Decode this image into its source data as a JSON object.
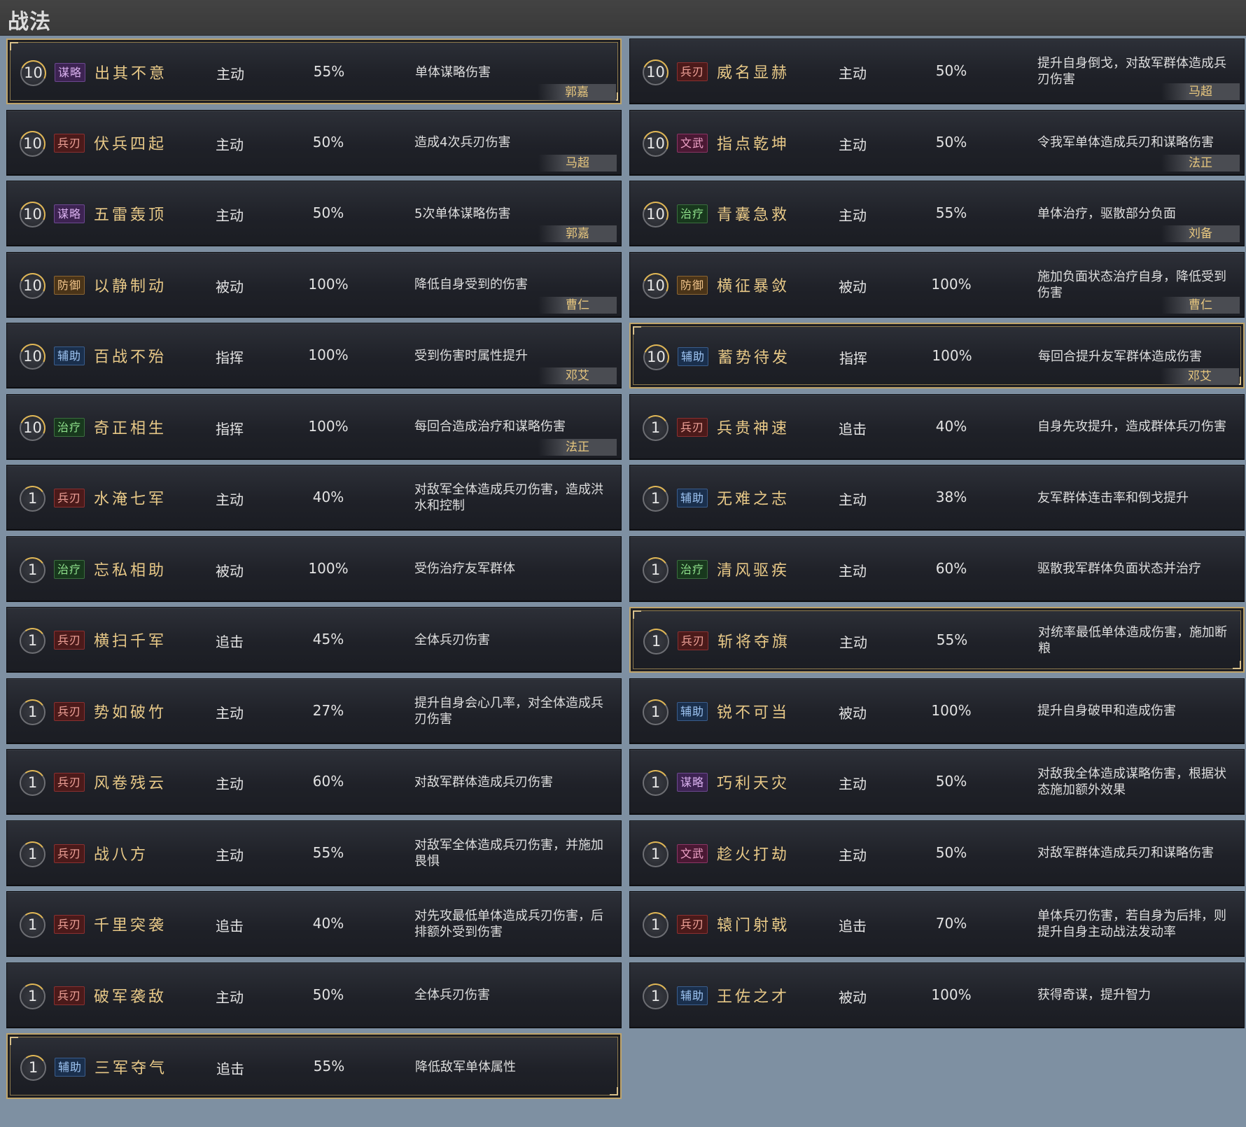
{
  "window": {
    "title": "战法"
  },
  "left_column": [
    {
      "level": "10",
      "category": "谋略",
      "cls": "c-moulue",
      "name": "出其不意",
      "type": "主动",
      "rate": "55%",
      "desc": "单体谋略伤害",
      "owner": "郭嘉",
      "highlight": true
    },
    {
      "level": "10",
      "category": "兵刃",
      "cls": "c-bingren",
      "name": "伏兵四起",
      "type": "主动",
      "rate": "50%",
      "desc": "造成4次兵刃伤害",
      "owner": "马超",
      "highlight": false
    },
    {
      "level": "10",
      "category": "谋略",
      "cls": "c-moulue",
      "name": "五雷轰顶",
      "type": "主动",
      "rate": "50%",
      "desc": "5次单体谋略伤害",
      "owner": "郭嘉",
      "highlight": false
    },
    {
      "level": "10",
      "category": "防御",
      "cls": "c-fangyu",
      "name": "以静制动",
      "type": "被动",
      "rate": "100%",
      "desc": "降低自身受到的伤害",
      "owner": "曹仁",
      "highlight": false
    },
    {
      "level": "10",
      "category": "辅助",
      "cls": "c-fuzhu",
      "name": "百战不殆",
      "type": "指挥",
      "rate": "100%",
      "desc": "受到伤害时属性提升",
      "owner": "邓艾",
      "highlight": false
    },
    {
      "level": "10",
      "category": "治疗",
      "cls": "c-zhiliao",
      "name": "奇正相生",
      "type": "指挥",
      "rate": "100%",
      "desc": "每回合造成治疗和谋略伤害",
      "owner": "法正",
      "highlight": false
    },
    {
      "level": "1",
      "category": "兵刃",
      "cls": "c-bingren",
      "name": "水淹七军",
      "type": "主动",
      "rate": "40%",
      "desc": "对敌军全体造成兵刃伤害，造成洪水和控制",
      "owner": "",
      "highlight": false
    },
    {
      "level": "1",
      "category": "治疗",
      "cls": "c-zhiliao",
      "name": "忘私相助",
      "type": "被动",
      "rate": "100%",
      "desc": "受伤治疗友军群体",
      "owner": "",
      "highlight": false
    },
    {
      "level": "1",
      "category": "兵刃",
      "cls": "c-bingren",
      "name": "横扫千军",
      "type": "追击",
      "rate": "45%",
      "desc": "全体兵刃伤害",
      "owner": "",
      "highlight": false
    },
    {
      "level": "1",
      "category": "兵刃",
      "cls": "c-bingren",
      "name": "势如破竹",
      "type": "主动",
      "rate": "27%",
      "desc": "提升自身会心几率，对全体造成兵刃伤害",
      "owner": "",
      "highlight": false
    },
    {
      "level": "1",
      "category": "兵刃",
      "cls": "c-bingren",
      "name": "风卷残云",
      "type": "主动",
      "rate": "60%",
      "desc": "对敌军群体造成兵刃伤害",
      "owner": "",
      "highlight": false
    },
    {
      "level": "1",
      "category": "兵刃",
      "cls": "c-bingren",
      "name": "战八方",
      "type": "主动",
      "rate": "55%",
      "desc": "对敌军全体造成兵刃伤害，并施加畏惧",
      "owner": "",
      "highlight": false
    },
    {
      "level": "1",
      "category": "兵刃",
      "cls": "c-bingren",
      "name": "千里突袭",
      "type": "追击",
      "rate": "40%",
      "desc": "对先攻最低单体造成兵刃伤害，后排额外受到伤害",
      "owner": "",
      "highlight": false
    },
    {
      "level": "1",
      "category": "兵刃",
      "cls": "c-bingren",
      "name": "破军袭敌",
      "type": "主动",
      "rate": "50%",
      "desc": "全体兵刃伤害",
      "owner": "",
      "highlight": false
    },
    {
      "level": "1",
      "category": "辅助",
      "cls": "c-fuzhu",
      "name": "三军夺气",
      "type": "追击",
      "rate": "55%",
      "desc": "降低敌军单体属性",
      "owner": "",
      "highlight": true
    }
  ],
  "right_column": [
    {
      "level": "10",
      "category": "兵刃",
      "cls": "c-bingren",
      "name": "威名显赫",
      "type": "主动",
      "rate": "50%",
      "desc": "提升自身倒戈，对敌军群体造成兵刃伤害",
      "owner": "马超",
      "highlight": false
    },
    {
      "level": "10",
      "category": "文武",
      "cls": "c-wenwu",
      "name": "指点乾坤",
      "type": "主动",
      "rate": "50%",
      "desc": "令我军单体造成兵刃和谋略伤害",
      "owner": "法正",
      "highlight": false
    },
    {
      "level": "10",
      "category": "治疗",
      "cls": "c-zhiliao",
      "name": "青囊急救",
      "type": "主动",
      "rate": "55%",
      "desc": "单体治疗，驱散部分负面",
      "owner": "刘备",
      "highlight": false
    },
    {
      "level": "10",
      "category": "防御",
      "cls": "c-fangyu",
      "name": "横征暴敛",
      "type": "被动",
      "rate": "100%",
      "desc": "施加负面状态治疗自身，降低受到伤害",
      "owner": "曹仁",
      "highlight": false
    },
    {
      "level": "10",
      "category": "辅助",
      "cls": "c-fuzhu",
      "name": "蓄势待发",
      "type": "指挥",
      "rate": "100%",
      "desc": "每回合提升友军群体造成伤害",
      "owner": "邓艾",
      "highlight": true
    },
    {
      "level": "1",
      "category": "兵刃",
      "cls": "c-bingren",
      "name": "兵贵神速",
      "type": "追击",
      "rate": "40%",
      "desc": "自身先攻提升，造成群体兵刃伤害",
      "owner": "",
      "highlight": false
    },
    {
      "level": "1",
      "category": "辅助",
      "cls": "c-fuzhu",
      "name": "无难之志",
      "type": "主动",
      "rate": "38%",
      "desc": "友军群体连击率和倒戈提升",
      "owner": "",
      "highlight": false
    },
    {
      "level": "1",
      "category": "治疗",
      "cls": "c-zhiliao",
      "name": "清风驱疾",
      "type": "主动",
      "rate": "60%",
      "desc": "驱散我军群体负面状态并治疗",
      "owner": "",
      "highlight": false
    },
    {
      "level": "1",
      "category": "兵刃",
      "cls": "c-bingren",
      "name": "斩将夺旗",
      "type": "主动",
      "rate": "55%",
      "desc": "对统率最低单体造成伤害，施加断粮",
      "owner": "",
      "highlight": true
    },
    {
      "level": "1",
      "category": "辅助",
      "cls": "c-fuzhu",
      "name": "锐不可当",
      "type": "被动",
      "rate": "100%",
      "desc": "提升自身破甲和造成伤害",
      "owner": "",
      "highlight": false
    },
    {
      "level": "1",
      "category": "谋略",
      "cls": "c-moulue",
      "name": "巧利天灾",
      "type": "主动",
      "rate": "50%",
      "desc": "对敌我全体造成谋略伤害，根据状态施加额外效果",
      "owner": "",
      "highlight": false
    },
    {
      "level": "1",
      "category": "文武",
      "cls": "c-wenwu",
      "name": "趁火打劫",
      "type": "主动",
      "rate": "50%",
      "desc": "对敌军群体造成兵刃和谋略伤害",
      "owner": "",
      "highlight": false
    },
    {
      "level": "1",
      "category": "兵刃",
      "cls": "c-bingren",
      "name": "辕门射戟",
      "type": "追击",
      "rate": "70%",
      "desc": "单体兵刃伤害，若自身为后排，则提升自身主动战法发动率",
      "owner": "",
      "highlight": false
    },
    {
      "level": "1",
      "category": "辅助",
      "cls": "c-fuzhu",
      "name": "王佐之才",
      "type": "被动",
      "rate": "100%",
      "desc": "获得奇谋，提升智力",
      "owner": "",
      "highlight": false
    }
  ]
}
